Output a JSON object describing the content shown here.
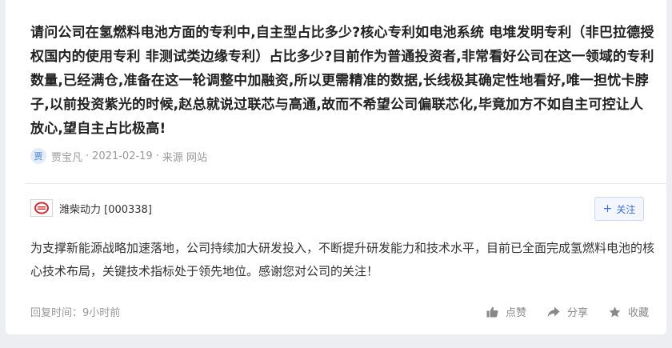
{
  "question": {
    "text": "请问公司在氢燃料电池方面的专利中,自主型占比多少?核心专利如电池系统 电堆发明专利（非巴拉德授权国内的使用专利 非测试类边缘专利）占比多少?目前作为普通投资者,非常看好公司在这一领域的专利数量,已经满仓,准备在这一轮调整中加融资,所以更需精准的数据,长线极其确定性地看好,唯一担忧卡脖子,以前投资紫光的时候,赵总就说过联芯与高通,故而不希望公司偏联芯化,毕竟加方不如自主可控让人放心,望自主占比极高!",
    "author_avatar": "贾",
    "author": "贾宝凡",
    "date": "2021-02-19",
    "source": "来源 网站"
  },
  "company": {
    "name": "潍柴动力 [000338]",
    "logo_icon": "weichai-logo"
  },
  "follow_button": {
    "icon": "plus-icon",
    "label": "关注"
  },
  "answer": {
    "text": "为支撑新能源战略加速落地，公司持续加大研发投入，不断提升研发能力和技术水平，目前已全面完成氢燃料电池的核心技术布局，关键技术指标处于领先地位。感谢您对公司的关注！"
  },
  "footer": {
    "reply_time": "回复时间：9小时前",
    "like_label": "点赞",
    "share_label": "分享",
    "favorite_label": "收藏"
  },
  "colors": {
    "accent": "#3a6fd8",
    "background": "#eceef1",
    "card": "#ffffff",
    "logo_red": "#d7262b"
  }
}
